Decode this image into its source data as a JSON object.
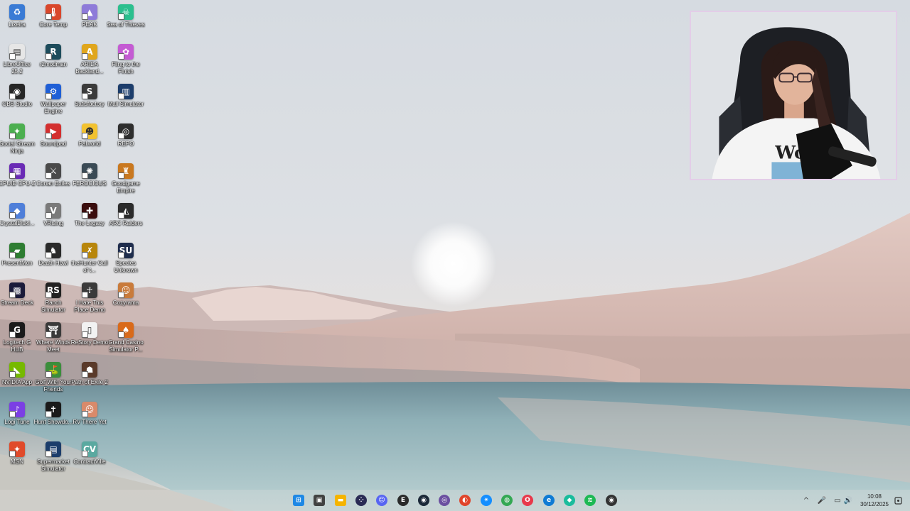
{
  "desktop": {
    "icons": [
      {
        "label": "Lixeira",
        "glyph": "♻",
        "color": "#3a7bd5",
        "col": 0,
        "row": 0,
        "shortcut": false
      },
      {
        "label": "Core Temp",
        "glyph": "🌡",
        "color": "#d9472b",
        "col": 1,
        "row": 0
      },
      {
        "label": "PEAK",
        "glyph": "▲",
        "color": "#8e7bd9",
        "col": 2,
        "row": 0
      },
      {
        "label": "Sea of Thieves",
        "glyph": "☠",
        "color": "#2bbf8e",
        "col": 3,
        "row": 0
      },
      {
        "label": "LibreOffice 25.2",
        "glyph": "▤",
        "color": "#e6e6e6",
        "col": 0,
        "row": 1
      },
      {
        "label": "r2modman",
        "glyph": "R",
        "color": "#1d4c5c",
        "col": 1,
        "row": 1
      },
      {
        "label": "ARIDA Backland...",
        "glyph": "A",
        "color": "#e0a61c",
        "col": 2,
        "row": 1
      },
      {
        "label": "Fling to the Finish",
        "glyph": "✿",
        "color": "#c45bd3",
        "col": 3,
        "row": 1
      },
      {
        "label": "OBS Studio",
        "glyph": "◉",
        "color": "#262626",
        "col": 0,
        "row": 2
      },
      {
        "label": "Wallpaper Engine",
        "glyph": "⚙",
        "color": "#1f5fd6",
        "col": 1,
        "row": 2
      },
      {
        "label": "Satisfactory",
        "glyph": "S",
        "color": "#3b3b3b",
        "col": 2,
        "row": 2
      },
      {
        "label": "Mall Simulator",
        "glyph": "▥",
        "color": "#1c3d6b",
        "col": 3,
        "row": 2
      },
      {
        "label": "Social Stream Ninja",
        "glyph": "✦",
        "color": "#4caf50",
        "col": 0,
        "row": 3
      },
      {
        "label": "Soundpad",
        "glyph": "▶",
        "color": "#d32f2f",
        "col": 1,
        "row": 3
      },
      {
        "label": "Palworld",
        "glyph": "☻",
        "color": "#f2c230",
        "col": 2,
        "row": 3
      },
      {
        "label": "REPO",
        "glyph": "◎",
        "color": "#2e2e2e",
        "col": 3,
        "row": 3
      },
      {
        "label": "CPUID CPU-Z",
        "glyph": "▦",
        "color": "#6a2bb5",
        "col": 0,
        "row": 4
      },
      {
        "label": "Conan Exiles",
        "glyph": "⚔",
        "color": "#4a4a4a",
        "col": 1,
        "row": 4
      },
      {
        "label": "FEROCIOUS",
        "glyph": "✺",
        "color": "#3a4a55",
        "col": 2,
        "row": 4
      },
      {
        "label": "Goodgame Empire",
        "glyph": "♜",
        "color": "#c9781f",
        "col": 3,
        "row": 4
      },
      {
        "label": "CrystalDiskI...",
        "glyph": "◆",
        "color": "#4f7fd9",
        "col": 0,
        "row": 5
      },
      {
        "label": "VRising",
        "glyph": "V",
        "color": "#7a7a7a",
        "col": 1,
        "row": 5
      },
      {
        "label": "The Legacy",
        "glyph": "✚",
        "color": "#3a0d0d",
        "col": 2,
        "row": 5
      },
      {
        "label": "ARC Raiders",
        "glyph": "◭",
        "color": "#2b2b2b",
        "col": 3,
        "row": 5
      },
      {
        "label": "PresentMon",
        "glyph": "▰",
        "color": "#2e7d32",
        "col": 0,
        "row": 6
      },
      {
        "label": "Death Howl",
        "glyph": "♞",
        "color": "#2a2a2a",
        "col": 1,
        "row": 6
      },
      {
        "label": "theHunter Call of t...",
        "glyph": "✗",
        "color": "#b8860b",
        "col": 2,
        "row": 6
      },
      {
        "label": "Species Unknown",
        "glyph": "SU",
        "color": "#1f2d4d",
        "col": 3,
        "row": 6
      },
      {
        "label": "Stream Deck",
        "glyph": "▩",
        "color": "#1b1b3a",
        "col": 0,
        "row": 7
      },
      {
        "label": "Ranch Simulator",
        "glyph": "RS",
        "color": "#222222",
        "col": 1,
        "row": 7
      },
      {
        "label": "I Hate This Place Demo",
        "glyph": "☥",
        "color": "#3a3a3a",
        "col": 2,
        "row": 7
      },
      {
        "label": "Cozyrama",
        "glyph": "☺",
        "color": "#c97b3b",
        "col": 3,
        "row": 7
      },
      {
        "label": "Logitech G HUB",
        "glyph": "G",
        "color": "#1a1a1a",
        "col": 0,
        "row": 8
      },
      {
        "label": "Where Winds Meet",
        "glyph": "⛩",
        "color": "#3a3a3a",
        "col": 1,
        "row": 8
      },
      {
        "label": "ReStory Demo",
        "glyph": "▯",
        "color": "#f2f2f2",
        "col": 2,
        "row": 8
      },
      {
        "label": "Grand Casino Simulator P...",
        "glyph": "♠",
        "color": "#d96a1a",
        "col": 3,
        "row": 8
      },
      {
        "label": "NVIDIA App",
        "glyph": "◣",
        "color": "#76b900",
        "col": 0,
        "row": 9
      },
      {
        "label": "Golf With Your Friends",
        "glyph": "⛳",
        "color": "#3b8e3b",
        "col": 1,
        "row": 9
      },
      {
        "label": "Path of Exile 2",
        "glyph": "☗",
        "color": "#5a3a2a",
        "col": 2,
        "row": 9
      },
      {
        "label": "Logi Tune",
        "glyph": "♪",
        "color": "#7b3fe4",
        "col": 0,
        "row": 10
      },
      {
        "label": "Hunt Showdo...",
        "glyph": "✝",
        "color": "#1a1a1a",
        "col": 1,
        "row": 10
      },
      {
        "label": "RV There Yet",
        "glyph": "☺",
        "color": "#d98a6a",
        "col": 2,
        "row": 10
      },
      {
        "label": "MSN",
        "glyph": "✦",
        "color": "#e04a2a",
        "col": 0,
        "row": 11
      },
      {
        "label": "Supermarket Simulator",
        "glyph": "▤",
        "color": "#1c3d6b",
        "col": 1,
        "row": 11
      },
      {
        "label": "ContractVille",
        "glyph": "CV",
        "color": "#5aa9a0",
        "col": 2,
        "row": 11
      }
    ]
  },
  "taskbar": {
    "apps": [
      {
        "name": "start-button",
        "glyph": "⊞",
        "color": "#1e88e5"
      },
      {
        "name": "task-view-button",
        "glyph": "▣",
        "color": "#424242"
      },
      {
        "name": "file-explorer",
        "glyph": "▬",
        "color": "#f5b400"
      },
      {
        "name": "app-dots",
        "glyph": "⁘",
        "color": "#2b2b55"
      },
      {
        "name": "discord",
        "glyph": "☺",
        "color": "#5865f2"
      },
      {
        "name": "epic-games",
        "glyph": "E",
        "color": "#2a2a2a"
      },
      {
        "name": "steam",
        "glyph": "◉",
        "color": "#1b2838"
      },
      {
        "name": "ubisoft-connect",
        "glyph": "◎",
        "color": "#6b4fa0"
      },
      {
        "name": "ea-app",
        "glyph": "◐",
        "color": "#e0442a"
      },
      {
        "name": "battle-net",
        "glyph": "✴",
        "color": "#148eff"
      },
      {
        "name": "chrome",
        "glyph": "◍",
        "color": "#34a853"
      },
      {
        "name": "opera",
        "glyph": "O",
        "color": "#e8394b"
      },
      {
        "name": "edge",
        "glyph": "e",
        "color": "#0f7bd4"
      },
      {
        "name": "app-cyan",
        "glyph": "◆",
        "color": "#1abc9c"
      },
      {
        "name": "spotify",
        "glyph": "≋",
        "color": "#1db954"
      },
      {
        "name": "obs-tray",
        "glyph": "◉",
        "color": "#333333"
      }
    ],
    "tray": [
      "^",
      "🎤",
      "▭",
      "🔊"
    ],
    "time": "10:08",
    "date": "30/12/2025"
  }
}
